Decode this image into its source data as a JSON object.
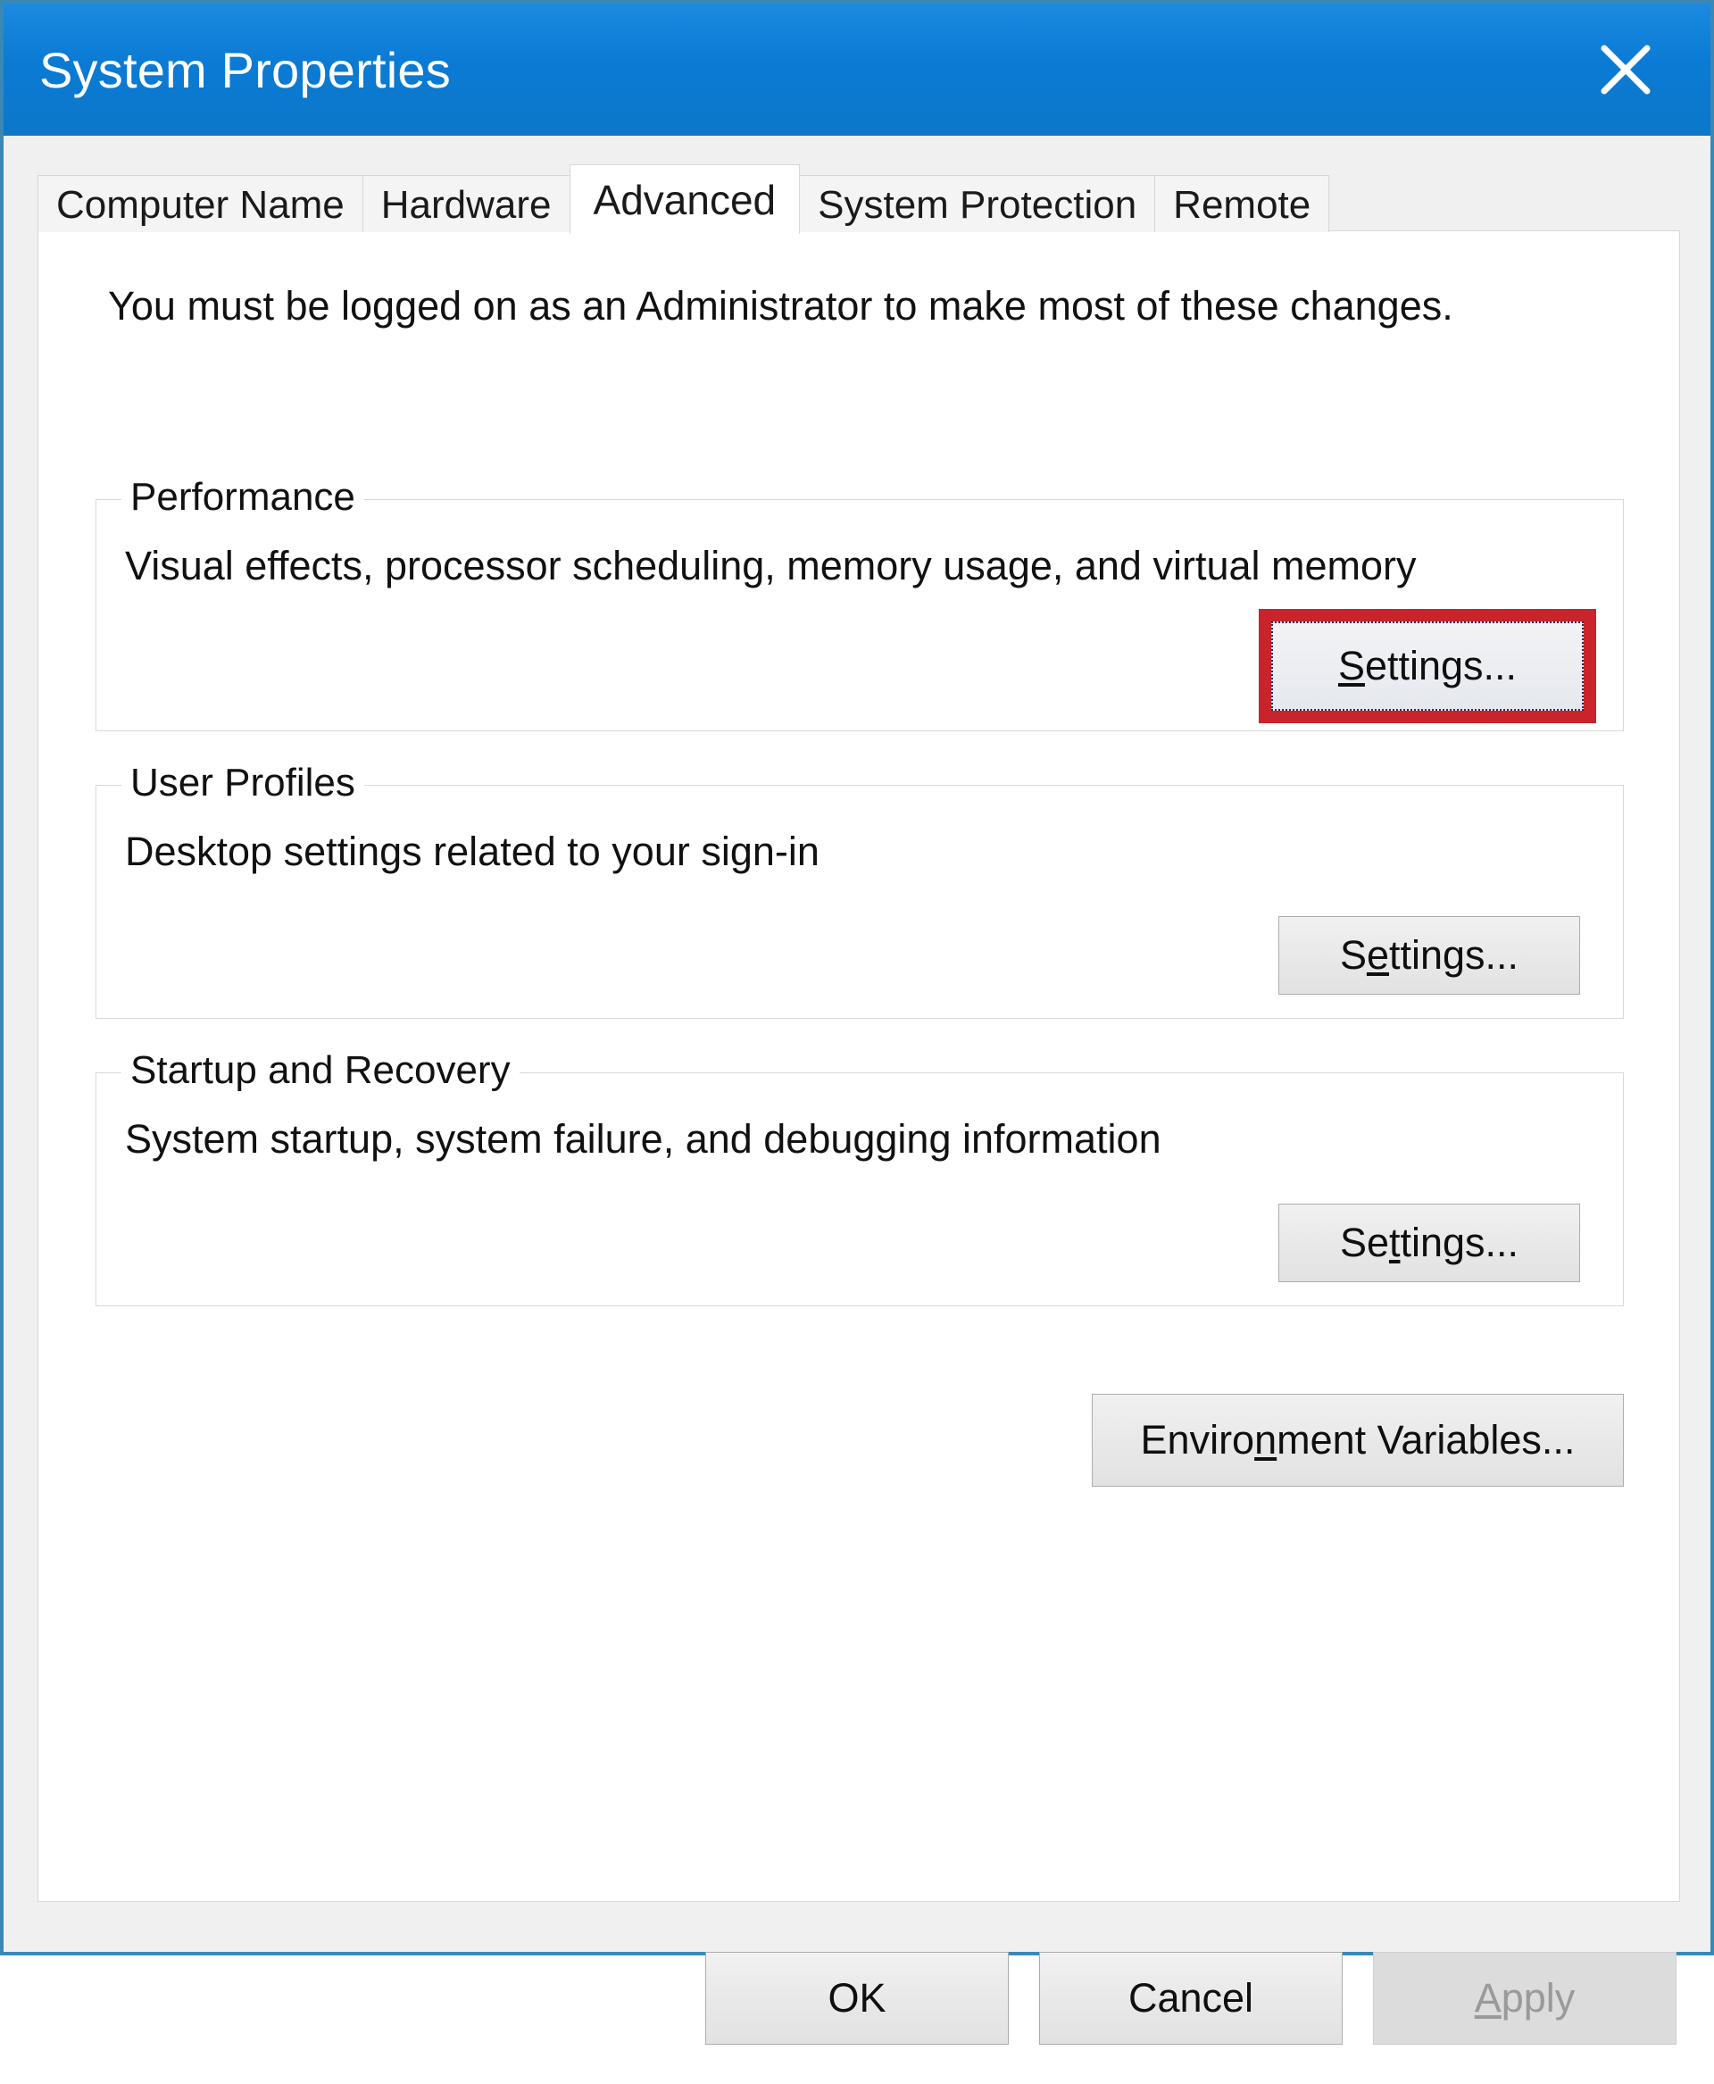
{
  "window": {
    "title": "System Properties",
    "close_icon": "close-icon",
    "accent_titlebar": "#0a7ad4",
    "frame_border": "#3b87b5"
  },
  "tabs": [
    {
      "label": "Computer Name",
      "active": false
    },
    {
      "label": "Hardware",
      "active": false
    },
    {
      "label": "Advanced",
      "active": true
    },
    {
      "label": "System Protection",
      "active": false
    },
    {
      "label": "Remote",
      "active": false
    }
  ],
  "panel": {
    "intro": "You must be logged on as an Administrator to make most of these changes.",
    "groups": [
      {
        "id": "performance",
        "label": "Performance",
        "description": "Visual effects, processor scheduling, memory usage, and virtual memory",
        "button": {
          "text_before": "",
          "accel": "S",
          "text_after": "ettings...",
          "highlighted": true,
          "highlight_color": "#c9232b",
          "focus_ring": true
        }
      },
      {
        "id": "user-profiles",
        "label": "User Profiles",
        "description": "Desktop settings related to your sign-in",
        "button": {
          "text_before": "S",
          "accel": "e",
          "text_after": "ttings...",
          "highlighted": false
        }
      },
      {
        "id": "startup-and-recovery",
        "label": "Startup and Recovery",
        "description": "System startup, system failure, and debugging information",
        "button": {
          "text_before": "Se",
          "accel": "t",
          "text_after": "tings...",
          "highlighted": false
        }
      }
    ],
    "env_button": {
      "text_before": "Enviro",
      "accel": "n",
      "text_after": "ment Variables..."
    }
  },
  "footer": {
    "ok": "OK",
    "cancel": "Cancel",
    "apply_before": "",
    "apply_accel": "A",
    "apply_after": "pply",
    "apply_enabled": false
  }
}
